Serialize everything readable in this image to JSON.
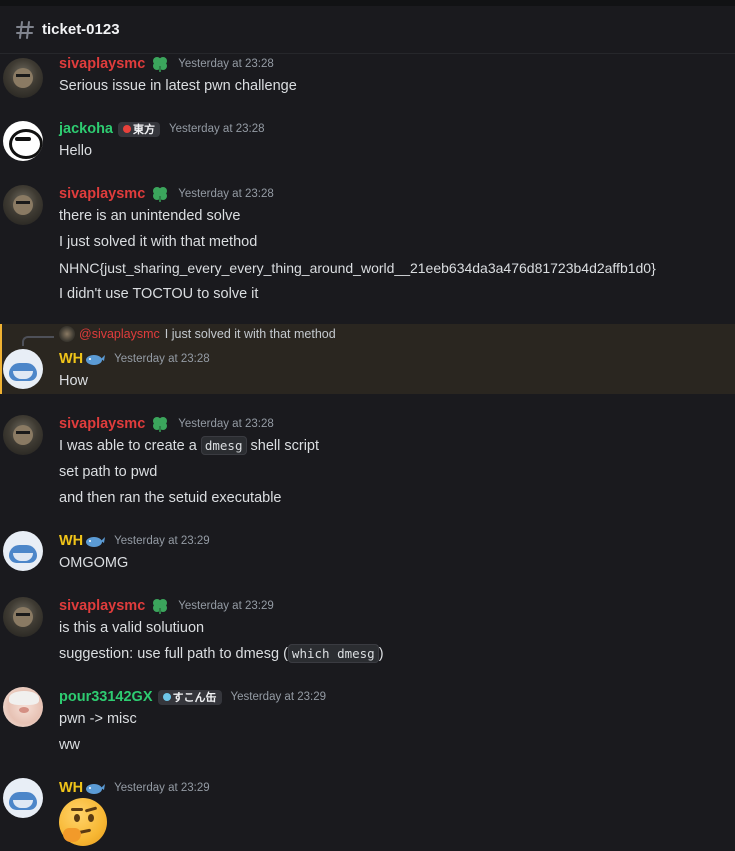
{
  "channel": {
    "name": "ticket-0123",
    "icon": "hash-icon"
  },
  "messages": [
    {
      "author": "sivaplaysmc",
      "badge": "clover-icon",
      "time": "Yesterday at 23:28",
      "lines": [
        "Serious issue in latest pwn challenge"
      ]
    },
    {
      "author": "jackoha",
      "tag": "東方",
      "time": "Yesterday at 23:28",
      "lines": [
        "Hello"
      ]
    },
    {
      "author": "sivaplaysmc",
      "badge": "clover-icon",
      "time": "Yesterday at 23:28",
      "lines": [
        "there is an unintended solve",
        "I just solved it with that method",
        "NHNC{just_sharing_every_every_thing_around_world__21eeb634da3a476d81723b4d2affb1d0}",
        "I didn't use TOCTOU to solve it"
      ]
    },
    {
      "author": "WH",
      "time": "Yesterday at 23:28",
      "reply_to": {
        "mention": "@sivaplaysmc",
        "text": "I just solved it with that method"
      },
      "lines": [
        "How"
      ]
    },
    {
      "author": "sivaplaysmc",
      "badge": "clover-icon",
      "time": "Yesterday at 23:28",
      "lines": [
        "I was able to create a",
        "dmesg",
        "shell script",
        "set path to pwd",
        "and then ran the setuid executable"
      ]
    },
    {
      "author": "WH",
      "time": "Yesterday at 23:29",
      "lines": [
        "OMGOMG"
      ]
    },
    {
      "author": "sivaplaysmc",
      "badge": "clover-icon",
      "time": "Yesterday at 23:29",
      "lines": [
        "is this a valid solutiuon",
        "suggestion: use full path to dmesg (",
        "which dmesg",
        ")"
      ]
    },
    {
      "author": "pour33142GX",
      "tag": "すこん缶",
      "time": "Yesterday at 23:29",
      "lines": [
        "pwn -> misc",
        "ww"
      ]
    },
    {
      "author": "WH",
      "time": "Yesterday at 23:29",
      "emoji": "thinking-face"
    }
  ],
  "colors": {
    "background": "#1a1a1e",
    "reply_highlight": "#2a2620",
    "siva": "#e03c3c",
    "green": "#2ecc71",
    "wh": "#f0c419"
  }
}
